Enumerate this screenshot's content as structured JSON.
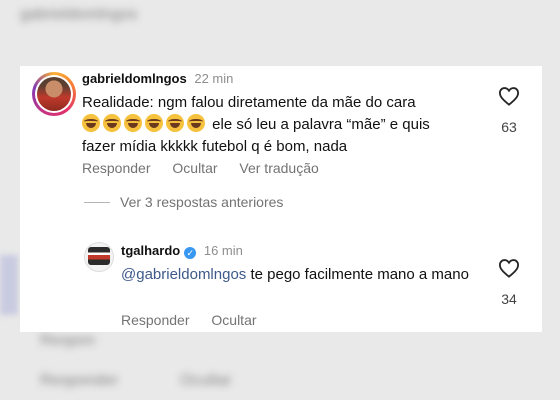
{
  "background": {
    "blur_line1": "gabrieldomlngos",
    "blur_line2": "",
    "blur_reply": "Respon",
    "blur_responder": "Responder",
    "blur_ocultar": "Ocultar"
  },
  "comments": [
    {
      "username": "gabrieldomlngos",
      "time": "22 min",
      "text_part1": "Realidade: ngm falou diretamente da mãe do cara",
      "emoji_name": "grinning-sweat-emoji",
      "text_part2": " ele só leu a palavra “mãe” e quis fazer mídia kkkkk futebol q é bom, nada",
      "likes": "63",
      "reply_label": "Responder",
      "hide_label": "Ocultar",
      "translate_label": "Ver tradução"
    },
    {
      "username": "tgalhardo",
      "verified": "✓",
      "time": "16 min",
      "mention": "@gabrieldomlngos",
      "text": " te pego facilmente mano a mano",
      "likes": "34",
      "reply_label": "Responder",
      "hide_label": "Ocultar"
    }
  ],
  "view_replies": "Ver 3 respostas anteriores",
  "colors": {
    "mention": "#3d5a8a",
    "muted": "#737373",
    "verified": "#3897f0"
  }
}
